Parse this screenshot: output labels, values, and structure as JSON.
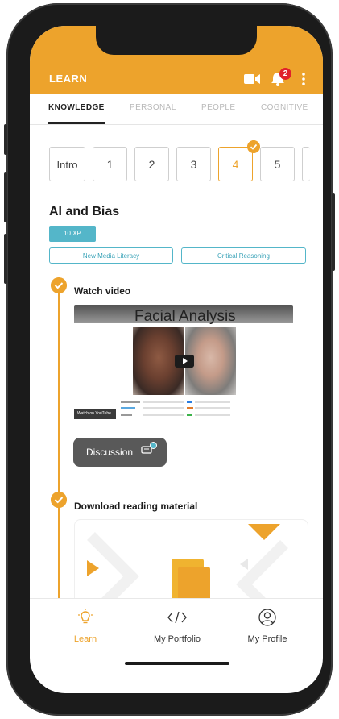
{
  "app": {
    "title": "LEARN",
    "notification_count": "2",
    "accent": "#eda32c",
    "teal": "#54b6c9"
  },
  "icons": {
    "camera": "video-camera-icon",
    "bell": "bell-icon",
    "menu": "kebab-menu-icon"
  },
  "tabs": [
    {
      "label": "KNOWLEDGE",
      "active": true
    },
    {
      "label": "PERSONAL"
    },
    {
      "label": "PEOPLE"
    },
    {
      "label": "COGNITIVE"
    }
  ],
  "steps": [
    "Intro",
    "1",
    "2",
    "3",
    "4",
    "5"
  ],
  "active_step": "4",
  "lesson": {
    "title": "AI and Bias",
    "xp": "10 XP",
    "skills": [
      "New Media Literacy",
      "Critical Reasoning"
    ]
  },
  "video_item": {
    "title": "Watch video",
    "video_title": "Facial Analysis",
    "watch_on": "Watch on YouTube",
    "discussion_label": "Discussion"
  },
  "reading_item": {
    "title": "Download reading material"
  },
  "bottom_nav": [
    {
      "label": "Learn",
      "icon": "lightbulb-icon",
      "active": true
    },
    {
      "label": "My Portfolio",
      "icon": "code-icon"
    },
    {
      "label": "My Profile",
      "icon": "profile-icon"
    }
  ]
}
